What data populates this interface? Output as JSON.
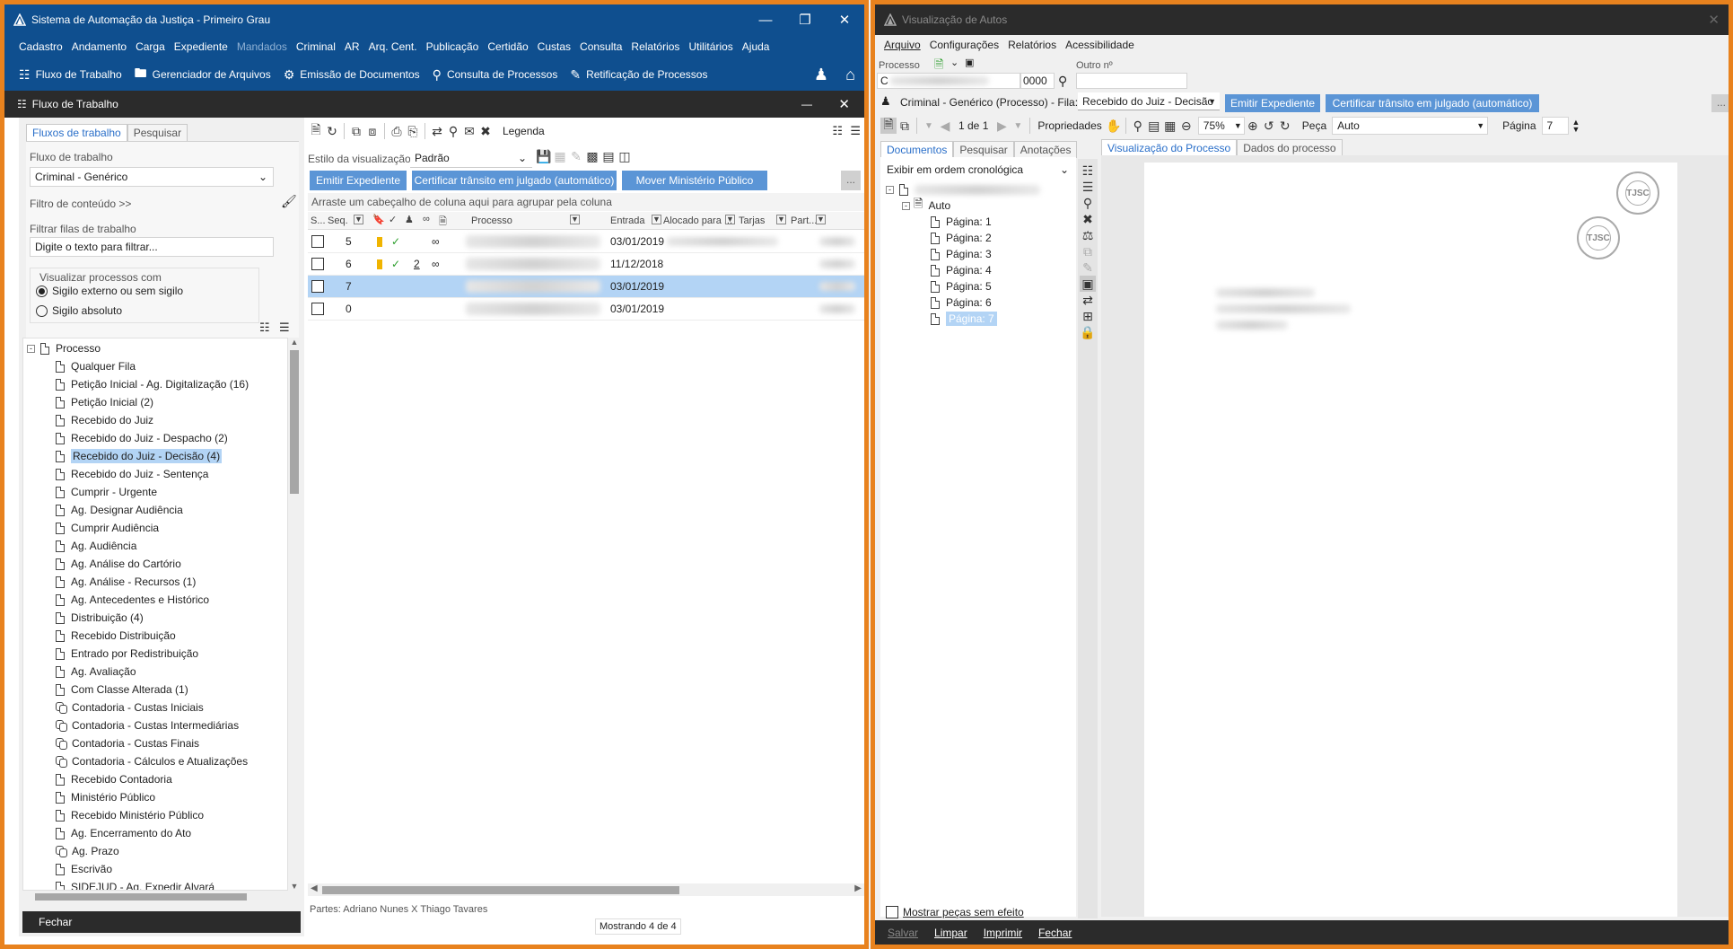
{
  "left_window": {
    "title": "Sistema de Automação da Justiça - Primeiro Grau",
    "menu": [
      "Cadastro",
      "Andamento",
      "Carga",
      "Expediente",
      "Mandados",
      "Criminal",
      "AR",
      "Arq. Cent.",
      "Publicação",
      "Certidão",
      "Custas",
      "Consulta",
      "Relatórios",
      "Utilitários",
      "Ajuda"
    ],
    "toolbar": {
      "fluxo": "Fluxo de Trabalho",
      "gerenciador": "Gerenciador de Arquivos",
      "emissao": "Emissão de Documentos",
      "consulta": "Consulta de Processos",
      "retificacao": "Retificação de Processos"
    },
    "panel_title": "Fluxo de Trabalho",
    "tabs": {
      "fluxos": "Fluxos de trabalho",
      "pesquisar": "Pesquisar"
    },
    "fluxo_label": "Fluxo de trabalho",
    "fluxo_value": "Criminal - Genérico",
    "filtro_conteudo": "Filtro de conteúdo >>",
    "filtrar_filas_label": "Filtrar filas de trabalho",
    "filtrar_placeholder": "Digite o texto para filtrar...",
    "visualizar_label": "Visualizar processos com",
    "radio1": "Sigilo externo ou sem sigilo",
    "radio2": "Sigilo absoluto",
    "tree_root": "Processo",
    "tree_items": [
      "Qualquer Fila",
      "Petição Inicial - Ag. Digitalização (16)",
      "Petição Inicial (2)",
      "Recebido do Juiz",
      "Recebido do Juiz - Despacho (2)",
      "Recebido do Juiz - Decisão (4)",
      "Recebido do Juiz - Sentença",
      "Cumprir - Urgente",
      "Ag. Designar Audiência",
      "Cumprir Audiência",
      "Ag. Audiência",
      "Ag. Análise do Cartório",
      "Ag. Análise - Recursos (1)",
      "Ag. Antecedentes e Histórico",
      "Distribuição (4)",
      "Recebido Distribuição",
      "Entrado por Redistribuição",
      "Ag. Avaliação",
      "Com Classe Alterada (1)",
      "Contadoria - Custas Iniciais",
      "Contadoria - Custas Intermediárias",
      "Contadoria - Custas Finais",
      "Contadoria - Cálculos e Atualizações",
      "Recebido Contadoria",
      "Ministério Público",
      "Recebido Ministério Público",
      "Ag. Encerramento do Ato",
      "Ag. Prazo",
      "Escrivão",
      "SIDEJUD - Ag. Expedir Alvará"
    ],
    "fechar": "Fechar",
    "legenda": "Legenda",
    "estilo_label": "Estilo da visualização",
    "estilo_value": "Padrão",
    "btn_emitir": "Emitir Expediente",
    "btn_certificar": "Certificar trânsito em julgado (automático)",
    "btn_mover": "Mover Ministério Público",
    "btn_more": "...",
    "group_hint": "Arraste um cabeçalho de coluna aqui para agrupar pela coluna",
    "columns": [
      "S...",
      "Seq.",
      "Processo",
      "Entrada",
      "Alocado para ...",
      "Tarjas",
      "Part..."
    ],
    "rows": [
      {
        "seq": "5",
        "entrada": "03/01/2019",
        "num": ""
      },
      {
        "seq": "6",
        "entrada": "11/12/2018",
        "num": "2"
      },
      {
        "seq": "7",
        "entrada": "03/01/2019",
        "num": ""
      },
      {
        "seq": "0",
        "entrada": "03/01/2019",
        "num": ""
      }
    ],
    "partes": "Partes: Adriano Nunes  X  Thiago Tavares",
    "mostrando": "Mostrando 4 de 4"
  },
  "right_window": {
    "title": "Visualização de Autos",
    "menu": [
      "Arquivo",
      "Configurações",
      "Relatórios",
      "Acessibilidade"
    ],
    "processo_label": "Processo",
    "processo_value": "C",
    "processo_suffix": "0000",
    "outro_label": "Outro nº",
    "fila_text": "Criminal - Genérico (Processo) - Fila:",
    "fila_value": "Recebido do Juiz - Decisão",
    "btn_emitir": "Emitir Expediente",
    "btn_certificar": "Certificar trânsito em julgado (automático)",
    "btn_more": "...",
    "page_of": "1 de 1",
    "propriedades": "Propriedades",
    "zoom": "75%",
    "peca_label": "Peça",
    "peca_value": "Auto",
    "pagina_label": "Página",
    "pagina_value": "7",
    "tabs_left": [
      "Documentos",
      "Pesquisar",
      "Anotações"
    ],
    "tabs_right": [
      "Visualização do Processo",
      "Dados do processo"
    ],
    "ordem": "Exibir em ordem cronológica",
    "auto": "Auto",
    "pages": [
      "Página: 1",
      "Página: 2",
      "Página: 3",
      "Página: 4",
      "Página: 5",
      "Página: 6",
      "Página: 7"
    ],
    "mostrar_pecas": "Mostrar peças sem efeito",
    "bottom": [
      "Salvar",
      "Limpar",
      "Imprimir",
      "Fechar"
    ],
    "stamp": "TJSC"
  },
  "colors": {
    "left_title": "#0f4f8f",
    "right_title": "#2b2b2b",
    "accent": "#e8821e",
    "button": "#5b95d6"
  }
}
